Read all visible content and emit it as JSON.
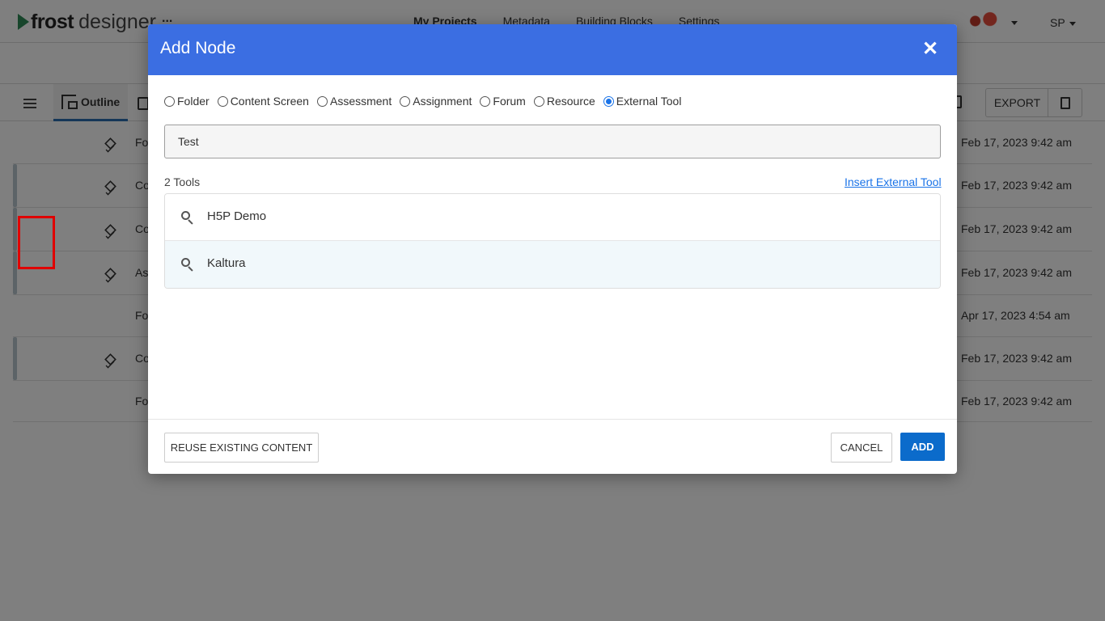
{
  "app": {
    "logo_primary": "frost",
    "logo_secondary": "designer",
    "more_label": "...",
    "nav": [
      "My Projects",
      "Metadata",
      "Building Blocks",
      "Settings"
    ],
    "user_initials": "SP"
  },
  "toolbar": {
    "outline_label": "Outline",
    "export_label": "EXPORT"
  },
  "rows": [
    {
      "title": "Fo",
      "date": "Feb 17, 2023 9:42 am",
      "has_bar": false,
      "has_icon": true
    },
    {
      "title": "Co",
      "date": "Feb 17, 2023 9:42 am",
      "has_bar": true,
      "has_icon": true
    },
    {
      "title": "Co",
      "date": "Feb 17, 2023 9:42 am",
      "has_bar": true,
      "has_icon": true
    },
    {
      "title": "As",
      "date": "Feb 17, 2023 9:42 am",
      "has_bar": true,
      "has_icon": true
    },
    {
      "title": "Fo",
      "date": "Apr 17, 2023 4:54 am",
      "has_bar": false,
      "has_icon": false
    },
    {
      "title": "Co",
      "date": "Feb 17, 2023 9:42 am",
      "has_bar": true,
      "has_icon": true
    },
    {
      "title": "Fo",
      "date": "Feb 17, 2023 9:42 am",
      "has_bar": false,
      "has_icon": false
    }
  ],
  "modal": {
    "title": "Add Node",
    "close_symbol": "✕",
    "node_types": [
      {
        "label": "Folder",
        "checked": false
      },
      {
        "label": "Content Screen",
        "checked": false
      },
      {
        "label": "Assessment",
        "checked": false
      },
      {
        "label": "Assignment",
        "checked": false
      },
      {
        "label": "Forum",
        "checked": false
      },
      {
        "label": "Resource",
        "checked": false
      },
      {
        "label": "External Tool",
        "checked": true
      }
    ],
    "name_value": "Test",
    "tools_count": "2 Tools",
    "insert_link": "Insert External Tool",
    "tools": [
      {
        "name": "H5P Demo",
        "icon": "search-icon"
      },
      {
        "name": "Kaltura",
        "icon": "search-icon"
      }
    ],
    "reuse_label": "REUSE EXISTING CONTENT",
    "cancel_label": "CANCEL",
    "add_label": "ADD"
  },
  "colors": {
    "header_blue": "#3b6ee2",
    "add_button": "#0b6bcb",
    "link": "#1a73e8",
    "highlight": "#e00000"
  }
}
